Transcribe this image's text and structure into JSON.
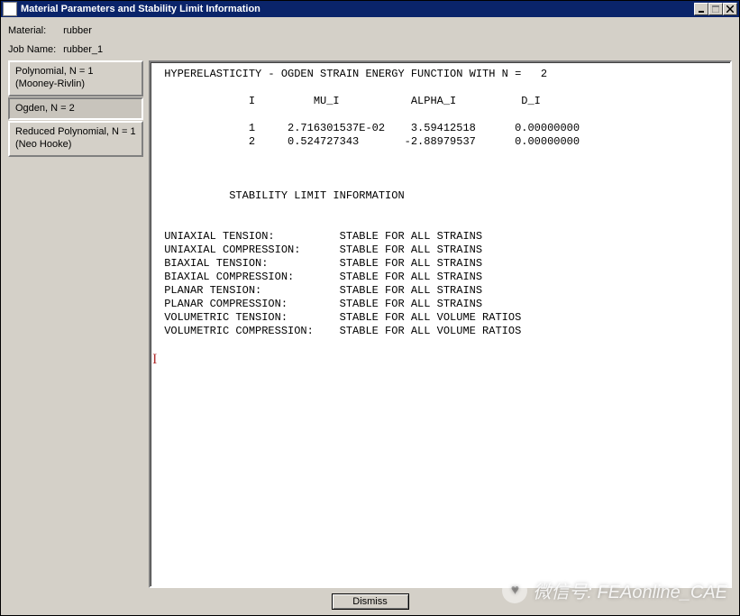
{
  "window": {
    "title": "Material Parameters and Stability Limit Information"
  },
  "header": {
    "material_label": "Material:",
    "material_value": "rubber",
    "jobname_label": "Job Name:",
    "jobname_value": "rubber_1"
  },
  "sidebar": {
    "items": [
      {
        "label": "Polynomial, N = 1\n(Mooney-Rivlin)",
        "selected": false
      },
      {
        "label": "Ogden, N = 2",
        "selected": true
      },
      {
        "label": "Reduced Polynomial, N = 1\n(Neo Hooke)",
        "selected": false
      }
    ]
  },
  "content": {
    "heading": " HYPERELASTICITY - OGDEN STRAIN ENERGY FUNCTION WITH N =   2",
    "col_header": "              I         MU_I           ALPHA_I          D_I",
    "rows": [
      "              1     2.716301537E-02    3.59412518      0.00000000",
      "              2     0.524727343       -2.88979537      0.00000000"
    ],
    "stability_title": "           STABILITY LIMIT INFORMATION",
    "stability_lines": [
      " UNIAXIAL TENSION:          STABLE FOR ALL STRAINS",
      " UNIAXIAL COMPRESSION:      STABLE FOR ALL STRAINS",
      " BIAXIAL TENSION:           STABLE FOR ALL STRAINS",
      " BIAXIAL COMPRESSION:       STABLE FOR ALL STRAINS",
      " PLANAR TENSION:            STABLE FOR ALL STRAINS",
      " PLANAR COMPRESSION:        STABLE FOR ALL STRAINS",
      " VOLUMETRIC TENSION:        STABLE FOR ALL VOLUME RATIOS",
      " VOLUMETRIC COMPRESSION:    STABLE FOR ALL VOLUME RATIOS"
    ]
  },
  "buttons": {
    "dismiss": "Dismiss"
  },
  "watermark": {
    "text": "微信号: FEAonline_CAE"
  }
}
